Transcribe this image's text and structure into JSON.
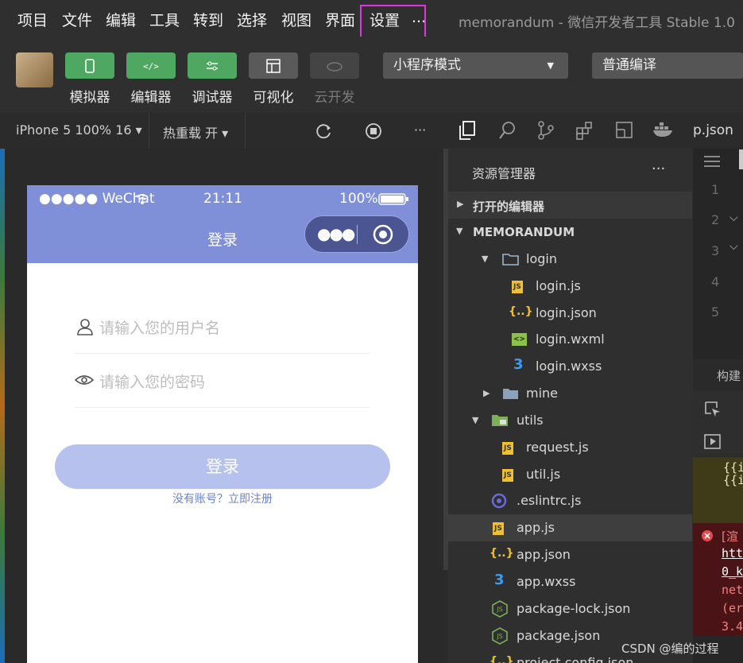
{
  "menu": [
    "项目",
    "文件",
    "编辑",
    "工具",
    "转到",
    "选择",
    "视图",
    "界面",
    "设置",
    "..."
  ],
  "window_title": "memorandum - 微信开发者工具 Stable 1.0",
  "toolbar": {
    "buttons": [
      {
        "label": "模拟器",
        "icon": "phone-icon",
        "style": "green"
      },
      {
        "label": "编辑器",
        "icon": "code-icon",
        "style": "green"
      },
      {
        "label": "调试器",
        "icon": "sliders-icon",
        "style": "green"
      },
      {
        "label": "可视化",
        "icon": "layout-icon",
        "style": "gray"
      },
      {
        "label": "云开发",
        "icon": "cloud-icon",
        "style": "disabled"
      }
    ],
    "mode_select": "小程序模式",
    "compile_select": "普通编译"
  },
  "simulator_bar": {
    "device": "iPhone 5 100% 16 ▾",
    "hot_reload": "热重载 开 ▾",
    "more": "···"
  },
  "phone": {
    "carrier": "●●●●● WeChat",
    "time": "21:11",
    "battery": "100%",
    "nav_title": "登录",
    "username_placeholder": "请输入您的用户名",
    "password_placeholder": "请输入您的密码",
    "login_button": "登录",
    "register_link": "没有账号？立即注册"
  },
  "explorer": {
    "title": "资源管理器",
    "more": "···",
    "open_editors": "打开的编辑器",
    "project": "MEMORANDUM",
    "tree": [
      {
        "label": "login",
        "icon": "folder-open-icon",
        "glyph": "▼",
        "depth": 1
      },
      {
        "label": "login.js",
        "icon": "js-file-icon",
        "glyph": "JS",
        "depth": 2
      },
      {
        "label": "login.json",
        "icon": "json-file-icon",
        "glyph": "{..}",
        "depth": 2
      },
      {
        "label": "login.wxml",
        "icon": "wxml-file-icon",
        "glyph": "<>",
        "depth": 2
      },
      {
        "label": "login.wxss",
        "icon": "wxss-file-icon",
        "glyph": "3",
        "depth": 2
      },
      {
        "label": "mine",
        "icon": "folder-icon",
        "glyph": "▶",
        "depth": 1
      },
      {
        "label": "utils",
        "icon": "folder-open-icon",
        "glyph": "▼",
        "depth": 0
      },
      {
        "label": "request.js",
        "icon": "js-file-icon",
        "glyph": "JS",
        "depth": 1
      },
      {
        "label": "util.js",
        "icon": "js-file-icon",
        "glyph": "JS",
        "depth": 1
      },
      {
        "label": ".eslintrc.js",
        "icon": "eslint-icon",
        "glyph": "◎",
        "depth": 0
      },
      {
        "label": "app.js",
        "icon": "js-file-icon",
        "glyph": "JS",
        "depth": 0,
        "selected": true
      },
      {
        "label": "app.json",
        "icon": "json-file-icon",
        "glyph": "{..}",
        "depth": 0
      },
      {
        "label": "app.wxss",
        "icon": "wxss-file-icon",
        "glyph": "3",
        "depth": 0
      },
      {
        "label": "package-lock.json",
        "icon": "node-json-icon",
        "glyph": "⬡",
        "depth": 0
      },
      {
        "label": "package.json",
        "icon": "node-json-icon",
        "glyph": "⬡",
        "depth": 0
      },
      {
        "label": "project.config.json",
        "icon": "json-file-icon",
        "glyph": "{..}",
        "depth": 0
      }
    ]
  },
  "editor": {
    "tab": "p.json",
    "line_numbers": [
      "1",
      "2",
      "3",
      "4",
      "5"
    ],
    "build_tab": "构建"
  },
  "watermark": "CSDN @编的过程",
  "colors": {
    "accent_green": "#4ea862",
    "phone_nav": "#7f8fd8",
    "login_button": "#b6c1ee",
    "highlight": "#e433e4"
  }
}
